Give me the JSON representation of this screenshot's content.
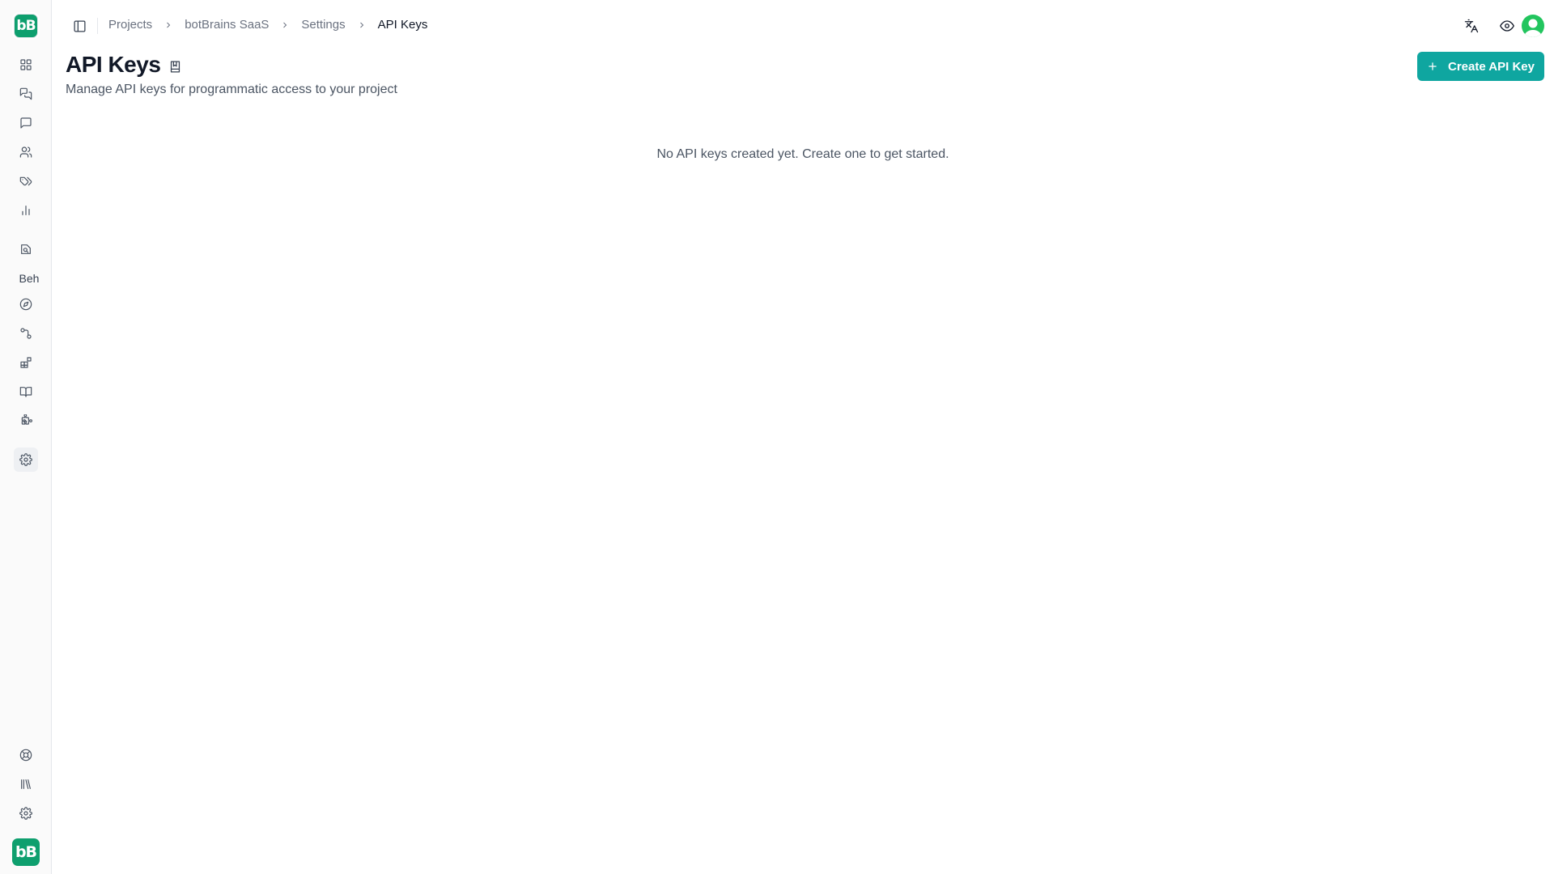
{
  "app": {
    "logo_text": "bB"
  },
  "sidebar": {
    "items": [
      {
        "icon": "dashboard-icon"
      },
      {
        "icon": "conversations-icon"
      },
      {
        "icon": "chat-icon"
      },
      {
        "icon": "users-icon"
      },
      {
        "icon": "tags-icon"
      },
      {
        "icon": "analytics-icon"
      },
      {
        "icon": "knowledge-icon"
      }
    ],
    "section_label": "Beh",
    "items2": [
      {
        "icon": "explore-icon"
      },
      {
        "icon": "workflow-icon"
      },
      {
        "icon": "integrations-icon"
      },
      {
        "icon": "docs-icon"
      },
      {
        "icon": "plugins-icon"
      },
      {
        "icon": "settings-icon",
        "active": true
      }
    ],
    "bottom_items": [
      {
        "icon": "help-icon"
      },
      {
        "icon": "library-icon"
      },
      {
        "icon": "gear-icon"
      }
    ]
  },
  "breadcrumb": {
    "items": [
      "Projects",
      "botBrains SaaS",
      "Settings",
      "API Keys"
    ]
  },
  "header": {
    "title": "API Keys",
    "subtitle": "Manage API keys for programmatic access to your project",
    "create_label": "Create API Key"
  },
  "empty_state": {
    "message": "No API keys created yet. Create one to get started."
  },
  "colors": {
    "brand": "#0e9f6e",
    "accent": "#0fa6a0",
    "avatar": "#22c55e"
  }
}
